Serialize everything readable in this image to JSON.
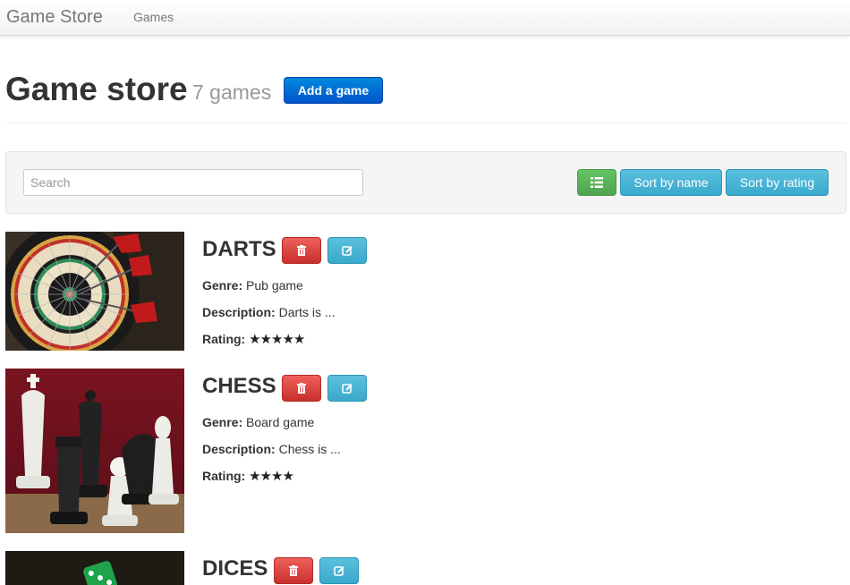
{
  "navbar": {
    "brand": "Game Store",
    "links": [
      "Games"
    ]
  },
  "header": {
    "title": "Game store",
    "subtitle": "7 games",
    "add_button": "Add a game"
  },
  "toolbar": {
    "search_placeholder": "Search",
    "list_view_icon": "list-icon",
    "sort_name_label": "Sort by name",
    "sort_rating_label": "Sort by rating"
  },
  "labels": {
    "genre": "Genre:",
    "description": "Description:",
    "rating": "Rating:"
  },
  "games": [
    {
      "name": "DARTS",
      "genre": "Pub game",
      "description": "Darts is ...",
      "rating": 5,
      "stars": "★★★★★",
      "image": "dartboard-image"
    },
    {
      "name": "CHESS",
      "genre": "Board game",
      "description": "Chess is ...",
      "rating": 4,
      "stars": "★★★★",
      "image": "chess-pieces-image"
    },
    {
      "name": "DICES",
      "image": "dice-image"
    }
  ],
  "colors": {
    "primary": "#0066cc",
    "success": "#5bb75b",
    "info": "#49afcd",
    "danger": "#da4f49"
  }
}
